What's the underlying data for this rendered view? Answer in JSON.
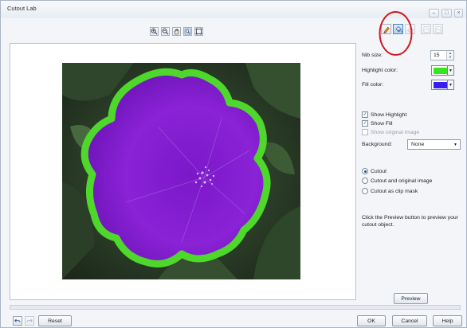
{
  "window": {
    "title": "Cutout Lab",
    "controls": [
      "minimize-icon",
      "maximize-icon",
      "close-icon"
    ]
  },
  "toolbar": {
    "left_tools": [
      "zoom-in-icon",
      "zoom-out-icon",
      "pan-hand-icon",
      "zoom-fit-icon",
      "actual-size-icon"
    ],
    "mode_tools": [
      {
        "icon": "highlighter-icon",
        "state": "normal"
      },
      {
        "icon": "fill-bucket-icon",
        "state": "active"
      },
      {
        "icon": "eraser-icon",
        "state": "disabled"
      },
      {
        "icon": "extract-icon",
        "state": "disabled"
      },
      {
        "icon": "remove-detail-icon",
        "state": "disabled"
      }
    ]
  },
  "panel": {
    "nib_size_label": "Nib size:",
    "nib_size_value": "15",
    "highlight_color_label": "Highlight color:",
    "highlight_color": "#35e51f",
    "fill_color_label": "Fill color:",
    "fill_color": "#3a1cf0",
    "show_highlight_label": "Show Highlight",
    "show_highlight_checked": true,
    "show_fill_label": "Show Fill",
    "show_fill_checked": true,
    "show_original_label": "Show original image",
    "show_original_checked": false,
    "background_label": "Background:",
    "background_value": "None",
    "radio_cutout": "Cutout",
    "radio_cutout_original": "Cutout and original image",
    "radio_clip_mask": "Cutout as clip mask",
    "selected_radio": "Cutout",
    "help_text": "Click the Preview button to preview your cutout object.",
    "preview_label": "Preview"
  },
  "footer": {
    "reset_label": "Reset",
    "ok_label": "OK",
    "cancel_label": "Cancel",
    "help_label": "Help"
  },
  "colors": {
    "overlay_fill": "#8a1fd2",
    "highlight_stroke": "#4fd82c",
    "annotation_circle": "#d2171f"
  }
}
